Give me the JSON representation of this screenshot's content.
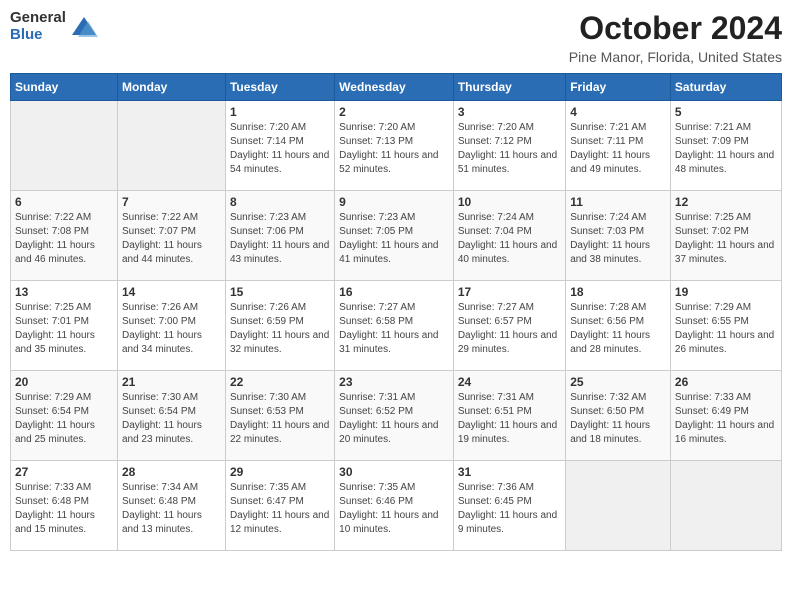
{
  "header": {
    "logo_general": "General",
    "logo_blue": "Blue",
    "month_title": "October 2024",
    "location": "Pine Manor, Florida, United States"
  },
  "days_of_week": [
    "Sunday",
    "Monday",
    "Tuesday",
    "Wednesday",
    "Thursday",
    "Friday",
    "Saturday"
  ],
  "weeks": [
    [
      {
        "day": "",
        "detail": ""
      },
      {
        "day": "",
        "detail": ""
      },
      {
        "day": "1",
        "detail": "Sunrise: 7:20 AM\nSunset: 7:14 PM\nDaylight: 11 hours and 54 minutes."
      },
      {
        "day": "2",
        "detail": "Sunrise: 7:20 AM\nSunset: 7:13 PM\nDaylight: 11 hours and 52 minutes."
      },
      {
        "day": "3",
        "detail": "Sunrise: 7:20 AM\nSunset: 7:12 PM\nDaylight: 11 hours and 51 minutes."
      },
      {
        "day": "4",
        "detail": "Sunrise: 7:21 AM\nSunset: 7:11 PM\nDaylight: 11 hours and 49 minutes."
      },
      {
        "day": "5",
        "detail": "Sunrise: 7:21 AM\nSunset: 7:09 PM\nDaylight: 11 hours and 48 minutes."
      }
    ],
    [
      {
        "day": "6",
        "detail": "Sunrise: 7:22 AM\nSunset: 7:08 PM\nDaylight: 11 hours and 46 minutes."
      },
      {
        "day": "7",
        "detail": "Sunrise: 7:22 AM\nSunset: 7:07 PM\nDaylight: 11 hours and 44 minutes."
      },
      {
        "day": "8",
        "detail": "Sunrise: 7:23 AM\nSunset: 7:06 PM\nDaylight: 11 hours and 43 minutes."
      },
      {
        "day": "9",
        "detail": "Sunrise: 7:23 AM\nSunset: 7:05 PM\nDaylight: 11 hours and 41 minutes."
      },
      {
        "day": "10",
        "detail": "Sunrise: 7:24 AM\nSunset: 7:04 PM\nDaylight: 11 hours and 40 minutes."
      },
      {
        "day": "11",
        "detail": "Sunrise: 7:24 AM\nSunset: 7:03 PM\nDaylight: 11 hours and 38 minutes."
      },
      {
        "day": "12",
        "detail": "Sunrise: 7:25 AM\nSunset: 7:02 PM\nDaylight: 11 hours and 37 minutes."
      }
    ],
    [
      {
        "day": "13",
        "detail": "Sunrise: 7:25 AM\nSunset: 7:01 PM\nDaylight: 11 hours and 35 minutes."
      },
      {
        "day": "14",
        "detail": "Sunrise: 7:26 AM\nSunset: 7:00 PM\nDaylight: 11 hours and 34 minutes."
      },
      {
        "day": "15",
        "detail": "Sunrise: 7:26 AM\nSunset: 6:59 PM\nDaylight: 11 hours and 32 minutes."
      },
      {
        "day": "16",
        "detail": "Sunrise: 7:27 AM\nSunset: 6:58 PM\nDaylight: 11 hours and 31 minutes."
      },
      {
        "day": "17",
        "detail": "Sunrise: 7:27 AM\nSunset: 6:57 PM\nDaylight: 11 hours and 29 minutes."
      },
      {
        "day": "18",
        "detail": "Sunrise: 7:28 AM\nSunset: 6:56 PM\nDaylight: 11 hours and 28 minutes."
      },
      {
        "day": "19",
        "detail": "Sunrise: 7:29 AM\nSunset: 6:55 PM\nDaylight: 11 hours and 26 minutes."
      }
    ],
    [
      {
        "day": "20",
        "detail": "Sunrise: 7:29 AM\nSunset: 6:54 PM\nDaylight: 11 hours and 25 minutes."
      },
      {
        "day": "21",
        "detail": "Sunrise: 7:30 AM\nSunset: 6:54 PM\nDaylight: 11 hours and 23 minutes."
      },
      {
        "day": "22",
        "detail": "Sunrise: 7:30 AM\nSunset: 6:53 PM\nDaylight: 11 hours and 22 minutes."
      },
      {
        "day": "23",
        "detail": "Sunrise: 7:31 AM\nSunset: 6:52 PM\nDaylight: 11 hours and 20 minutes."
      },
      {
        "day": "24",
        "detail": "Sunrise: 7:31 AM\nSunset: 6:51 PM\nDaylight: 11 hours and 19 minutes."
      },
      {
        "day": "25",
        "detail": "Sunrise: 7:32 AM\nSunset: 6:50 PM\nDaylight: 11 hours and 18 minutes."
      },
      {
        "day": "26",
        "detail": "Sunrise: 7:33 AM\nSunset: 6:49 PM\nDaylight: 11 hours and 16 minutes."
      }
    ],
    [
      {
        "day": "27",
        "detail": "Sunrise: 7:33 AM\nSunset: 6:48 PM\nDaylight: 11 hours and 15 minutes."
      },
      {
        "day": "28",
        "detail": "Sunrise: 7:34 AM\nSunset: 6:48 PM\nDaylight: 11 hours and 13 minutes."
      },
      {
        "day": "29",
        "detail": "Sunrise: 7:35 AM\nSunset: 6:47 PM\nDaylight: 11 hours and 12 minutes."
      },
      {
        "day": "30",
        "detail": "Sunrise: 7:35 AM\nSunset: 6:46 PM\nDaylight: 11 hours and 10 minutes."
      },
      {
        "day": "31",
        "detail": "Sunrise: 7:36 AM\nSunset: 6:45 PM\nDaylight: 11 hours and 9 minutes."
      },
      {
        "day": "",
        "detail": ""
      },
      {
        "day": "",
        "detail": ""
      }
    ]
  ]
}
